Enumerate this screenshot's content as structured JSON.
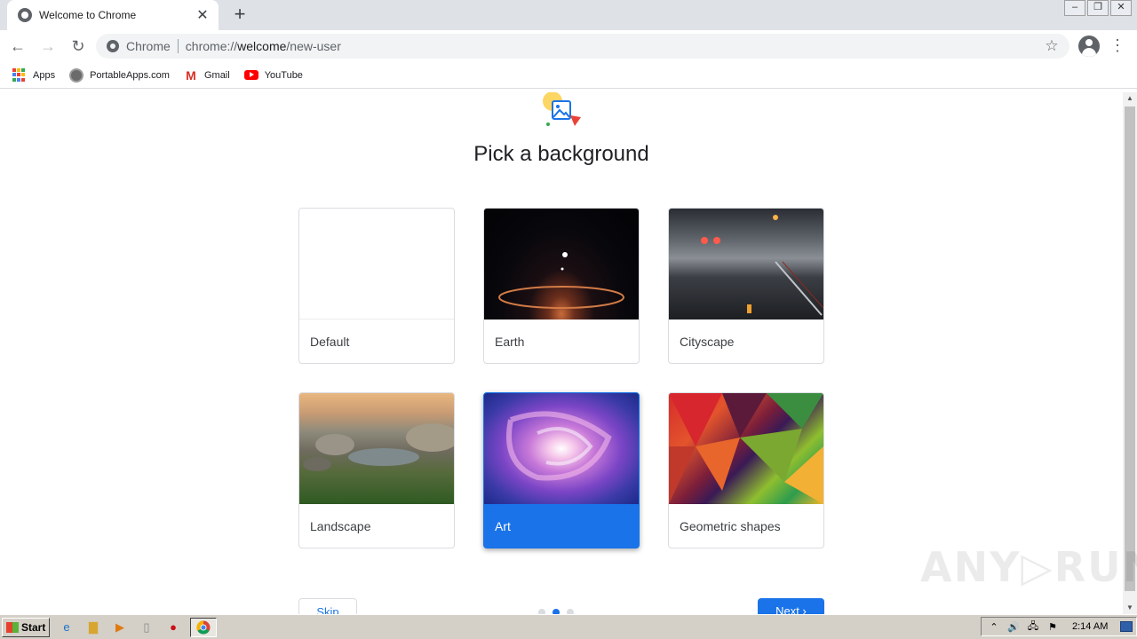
{
  "tab": {
    "title": "Welcome to Chrome",
    "close": "✕",
    "new_tab": "+"
  },
  "window_controls": {
    "minimize": "–",
    "restore": "❐",
    "close": "✕"
  },
  "toolbar": {
    "back": "←",
    "forward": "→",
    "reload": "↻",
    "chip": "Chrome",
    "url_host": "chrome://",
    "url_path_bold": "welcome",
    "url_rest": "/new-user",
    "star": "☆",
    "menu": "⋮"
  },
  "bookmarks": [
    {
      "label": "Apps",
      "icon": "apps-grid-icon"
    },
    {
      "label": "PortableApps.com",
      "icon": "portableapps-icon"
    },
    {
      "label": "Gmail",
      "icon": "gmail-icon"
    },
    {
      "label": "YouTube",
      "icon": "youtube-icon"
    }
  ],
  "page": {
    "title": "Pick a background",
    "backgrounds": [
      {
        "label": "Default",
        "selected": false
      },
      {
        "label": "Earth",
        "selected": false
      },
      {
        "label": "Cityscape",
        "selected": false
      },
      {
        "label": "Landscape",
        "selected": false
      },
      {
        "label": "Art",
        "selected": true
      },
      {
        "label": "Geometric shapes",
        "selected": false
      }
    ],
    "skip_label": "Skip",
    "next_label": "Next ›",
    "step_current": 2,
    "step_total": 3
  },
  "watermark": "ANY▷RUN",
  "taskbar": {
    "start_label": "Start",
    "tray_icons": [
      "⌃",
      "🔊",
      "🖧",
      "⚑"
    ],
    "clock": "2:14 AM"
  },
  "colors": {
    "accent": "#1a73e8",
    "tabstrip": "#dee1e6"
  }
}
